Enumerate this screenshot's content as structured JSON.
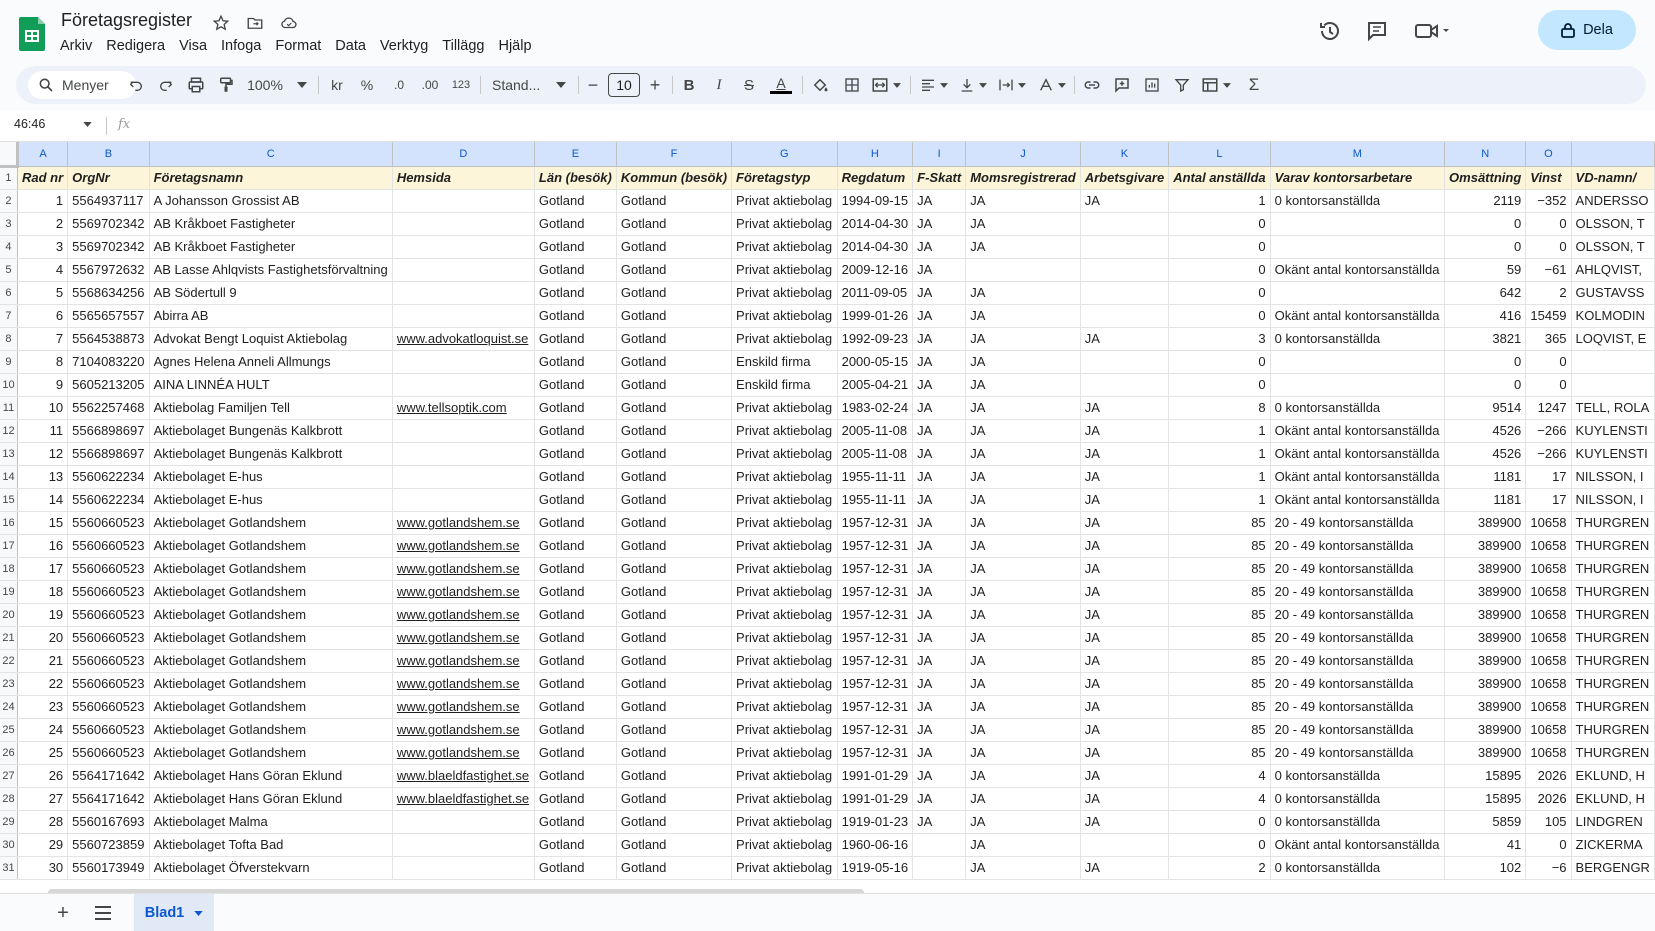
{
  "app": {
    "title": "Företagsregister",
    "menus": [
      "Arkiv",
      "Redigera",
      "Visa",
      "Infoga",
      "Format",
      "Data",
      "Verktyg",
      "Tillägg",
      "Hjälp"
    ],
    "share_label": "Dela"
  },
  "toolbar": {
    "search_label": "Menyer",
    "zoom": "100%",
    "currency": "kr",
    "percent": "%",
    "dec_decrease": ".0",
    "dec_increase": ".00",
    "number_format": "123",
    "font": "Stand...",
    "font_size": "10",
    "bold": "B",
    "italic": "I",
    "strike": "S",
    "text_color": "A",
    "sum": "Σ"
  },
  "formula_bar": {
    "cell_ref": "46:46",
    "fx": "fx",
    "value": ""
  },
  "colors": {
    "accent": "#0b57d0",
    "header_fill": "#fcf5d9",
    "share_bg": "#c2e7ff"
  },
  "grid": {
    "columns": [
      "A",
      "B",
      "C",
      "D",
      "E",
      "F",
      "G",
      "H",
      "I",
      "J",
      "K",
      "L",
      "M",
      "N",
      "O",
      ""
    ],
    "row_numbers": [
      1,
      2,
      3,
      4,
      5,
      6,
      7,
      8,
      9,
      10,
      11,
      12,
      13,
      14,
      15,
      16,
      17,
      18,
      19,
      20,
      21,
      22,
      23,
      24,
      25,
      26,
      27,
      28,
      29,
      30,
      31
    ],
    "header": [
      "Rad nr",
      "OrgNr",
      "Företagsnamn",
      "Hemsida",
      "Län (besök)",
      "Kommun (besök)",
      "Företagstyp",
      "Regdatum",
      "F-Skatt",
      "Momsregistrerad",
      "Arbetsgivare",
      "Antal anställda",
      "Varav kontorsarbetare",
      "Omsättning",
      "Vinst",
      "VD-namn/"
    ],
    "rows": [
      [
        "1",
        "5564937117",
        "A Johansson Grossist AB",
        "",
        "Gotland",
        "Gotland",
        "Privat aktiebolag",
        "1994-09-15",
        "JA",
        "JA",
        "JA",
        "1",
        "0 kontorsanställda",
        "2119",
        "−352",
        "ANDERSSO"
      ],
      [
        "2",
        "5569702342",
        "AB Kråkboet Fastigheter",
        "",
        "Gotland",
        "Gotland",
        "Privat aktiebolag",
        "2014-04-30",
        "JA",
        "JA",
        "",
        "0",
        "",
        "0",
        "0",
        "OLSSON, T"
      ],
      [
        "3",
        "5569702342",
        "AB Kråkboet Fastigheter",
        "",
        "Gotland",
        "Gotland",
        "Privat aktiebolag",
        "2014-04-30",
        "JA",
        "JA",
        "",
        "0",
        "",
        "0",
        "0",
        "OLSSON, T"
      ],
      [
        "4",
        "5567972632",
        "AB Lasse Ahlqvists Fastighetsförvaltning",
        "",
        "Gotland",
        "Gotland",
        "Privat aktiebolag",
        "2009-12-16",
        "JA",
        "",
        "",
        "0",
        "Okänt antal kontorsanställda",
        "59",
        "−61",
        "AHLQVIST,"
      ],
      [
        "5",
        "5568634256",
        "AB Södertull 9",
        "",
        "Gotland",
        "Gotland",
        "Privat aktiebolag",
        "2011-09-05",
        "JA",
        "JA",
        "",
        "0",
        "",
        "642",
        "2",
        "GUSTAVSS"
      ],
      [
        "6",
        "5565657557",
        "Abirra AB",
        "",
        "Gotland",
        "Gotland",
        "Privat aktiebolag",
        "1999-01-26",
        "JA",
        "JA",
        "",
        "0",
        "Okänt antal kontorsanställda",
        "416",
        "15459",
        "KOLMODIN"
      ],
      [
        "7",
        "5564538873",
        "Advokat Bengt Loquist Aktiebolag",
        "www.advokatloquist.se",
        "Gotland",
        "Gotland",
        "Privat aktiebolag",
        "1992-09-23",
        "JA",
        "JA",
        "JA",
        "3",
        "0 kontorsanställda",
        "3821",
        "365",
        "LOQVIST, E"
      ],
      [
        "8",
        "7104083220",
        "Agnes Helena Anneli Allmungs",
        "",
        "Gotland",
        "Gotland",
        "Enskild firma",
        "2000-05-15",
        "JA",
        "JA",
        "",
        "0",
        "",
        "0",
        "0",
        ""
      ],
      [
        "9",
        "5605213205",
        "AINA LINNÉA HULT",
        "",
        "Gotland",
        "Gotland",
        "Enskild firma",
        "2005-04-21",
        "JA",
        "JA",
        "",
        "0",
        "",
        "0",
        "0",
        ""
      ],
      [
        "10",
        "5562257468",
        "Aktiebolag Familjen Tell",
        "www.tellsoptik.com",
        "Gotland",
        "Gotland",
        "Privat aktiebolag",
        "1983-02-24",
        "JA",
        "JA",
        "JA",
        "8",
        "0 kontorsanställda",
        "9514",
        "1247",
        "TELL, ROLA"
      ],
      [
        "11",
        "5566898697",
        "Aktiebolaget Bungenäs Kalkbrott",
        "",
        "Gotland",
        "Gotland",
        "Privat aktiebolag",
        "2005-11-08",
        "JA",
        "JA",
        "JA",
        "1",
        "Okänt antal kontorsanställda",
        "4526",
        "−266",
        "KUYLENSTI"
      ],
      [
        "12",
        "5566898697",
        "Aktiebolaget Bungenäs Kalkbrott",
        "",
        "Gotland",
        "Gotland",
        "Privat aktiebolag",
        "2005-11-08",
        "JA",
        "JA",
        "JA",
        "1",
        "Okänt antal kontorsanställda",
        "4526",
        "−266",
        "KUYLENSTI"
      ],
      [
        "13",
        "5560622234",
        "Aktiebolaget E-hus",
        "",
        "Gotland",
        "Gotland",
        "Privat aktiebolag",
        "1955-11-11",
        "JA",
        "JA",
        "JA",
        "1",
        "Okänt antal kontorsanställda",
        "1181",
        "17",
        "NILSSON, I"
      ],
      [
        "14",
        "5560622234",
        "Aktiebolaget E-hus",
        "",
        "Gotland",
        "Gotland",
        "Privat aktiebolag",
        "1955-11-11",
        "JA",
        "JA",
        "JA",
        "1",
        "Okänt antal kontorsanställda",
        "1181",
        "17",
        "NILSSON, I"
      ],
      [
        "15",
        "5560660523",
        "Aktiebolaget Gotlandshem",
        "www.gotlandshem.se",
        "Gotland",
        "Gotland",
        "Privat aktiebolag",
        "1957-12-31",
        "JA",
        "JA",
        "JA",
        "85",
        "20 - 49 kontorsanställda",
        "389900",
        "10658",
        "THURGREN"
      ],
      [
        "16",
        "5560660523",
        "Aktiebolaget Gotlandshem",
        "www.gotlandshem.se",
        "Gotland",
        "Gotland",
        "Privat aktiebolag",
        "1957-12-31",
        "JA",
        "JA",
        "JA",
        "85",
        "20 - 49 kontorsanställda",
        "389900",
        "10658",
        "THURGREN"
      ],
      [
        "17",
        "5560660523",
        "Aktiebolaget Gotlandshem",
        "www.gotlandshem.se",
        "Gotland",
        "Gotland",
        "Privat aktiebolag",
        "1957-12-31",
        "JA",
        "JA",
        "JA",
        "85",
        "20 - 49 kontorsanställda",
        "389900",
        "10658",
        "THURGREN"
      ],
      [
        "18",
        "5560660523",
        "Aktiebolaget Gotlandshem",
        "www.gotlandshem.se",
        "Gotland",
        "Gotland",
        "Privat aktiebolag",
        "1957-12-31",
        "JA",
        "JA",
        "JA",
        "85",
        "20 - 49 kontorsanställda",
        "389900",
        "10658",
        "THURGREN"
      ],
      [
        "19",
        "5560660523",
        "Aktiebolaget Gotlandshem",
        "www.gotlandshem.se",
        "Gotland",
        "Gotland",
        "Privat aktiebolag",
        "1957-12-31",
        "JA",
        "JA",
        "JA",
        "85",
        "20 - 49 kontorsanställda",
        "389900",
        "10658",
        "THURGREN"
      ],
      [
        "20",
        "5560660523",
        "Aktiebolaget Gotlandshem",
        "www.gotlandshem.se",
        "Gotland",
        "Gotland",
        "Privat aktiebolag",
        "1957-12-31",
        "JA",
        "JA",
        "JA",
        "85",
        "20 - 49 kontorsanställda",
        "389900",
        "10658",
        "THURGREN"
      ],
      [
        "21",
        "5560660523",
        "Aktiebolaget Gotlandshem",
        "www.gotlandshem.se",
        "Gotland",
        "Gotland",
        "Privat aktiebolag",
        "1957-12-31",
        "JA",
        "JA",
        "JA",
        "85",
        "20 - 49 kontorsanställda",
        "389900",
        "10658",
        "THURGREN"
      ],
      [
        "22",
        "5560660523",
        "Aktiebolaget Gotlandshem",
        "www.gotlandshem.se",
        "Gotland",
        "Gotland",
        "Privat aktiebolag",
        "1957-12-31",
        "JA",
        "JA",
        "JA",
        "85",
        "20 - 49 kontorsanställda",
        "389900",
        "10658",
        "THURGREN"
      ],
      [
        "23",
        "5560660523",
        "Aktiebolaget Gotlandshem",
        "www.gotlandshem.se",
        "Gotland",
        "Gotland",
        "Privat aktiebolag",
        "1957-12-31",
        "JA",
        "JA",
        "JA",
        "85",
        "20 - 49 kontorsanställda",
        "389900",
        "10658",
        "THURGREN"
      ],
      [
        "24",
        "5560660523",
        "Aktiebolaget Gotlandshem",
        "www.gotlandshem.se",
        "Gotland",
        "Gotland",
        "Privat aktiebolag",
        "1957-12-31",
        "JA",
        "JA",
        "JA",
        "85",
        "20 - 49 kontorsanställda",
        "389900",
        "10658",
        "THURGREN"
      ],
      [
        "25",
        "5560660523",
        "Aktiebolaget Gotlandshem",
        "www.gotlandshem.se",
        "Gotland",
        "Gotland",
        "Privat aktiebolag",
        "1957-12-31",
        "JA",
        "JA",
        "JA",
        "85",
        "20 - 49 kontorsanställda",
        "389900",
        "10658",
        "THURGREN"
      ],
      [
        "26",
        "5564171642",
        "Aktiebolaget Hans Göran Eklund",
        "www.blaeldfastighet.se",
        "Gotland",
        "Gotland",
        "Privat aktiebolag",
        "1991-01-29",
        "JA",
        "JA",
        "JA",
        "4",
        "0 kontorsanställda",
        "15895",
        "2026",
        "EKLUND, H"
      ],
      [
        "27",
        "5564171642",
        "Aktiebolaget Hans Göran Eklund",
        "www.blaeldfastighet.se",
        "Gotland",
        "Gotland",
        "Privat aktiebolag",
        "1991-01-29",
        "JA",
        "JA",
        "JA",
        "4",
        "0 kontorsanställda",
        "15895",
        "2026",
        "EKLUND, H"
      ],
      [
        "28",
        "5560167693",
        "Aktiebolaget Malma",
        "",
        "Gotland",
        "Gotland",
        "Privat aktiebolag",
        "1919-01-23",
        "JA",
        "JA",
        "JA",
        "0",
        "0 kontorsanställda",
        "5859",
        "105",
        "LINDGREN"
      ],
      [
        "29",
        "5560723859",
        "Aktiebolaget Tofta Bad",
        "",
        "Gotland",
        "Gotland",
        "Privat aktiebolag",
        "1960-06-16",
        "",
        "JA",
        "",
        "0",
        "Okänt antal kontorsanställda",
        "41",
        "0",
        "ZICKERMA"
      ],
      [
        "30",
        "5560173949",
        "Aktiebolaget Öfverstekvarn",
        "",
        "Gotland",
        "Gotland",
        "Privat aktiebolag",
        "1919-05-16",
        "",
        "JA",
        "JA",
        "2",
        "0 kontorsanställda",
        "102",
        "−6",
        "BERGENGR"
      ]
    ]
  },
  "sheets": [
    {
      "name": "Blad1",
      "active": true
    }
  ]
}
